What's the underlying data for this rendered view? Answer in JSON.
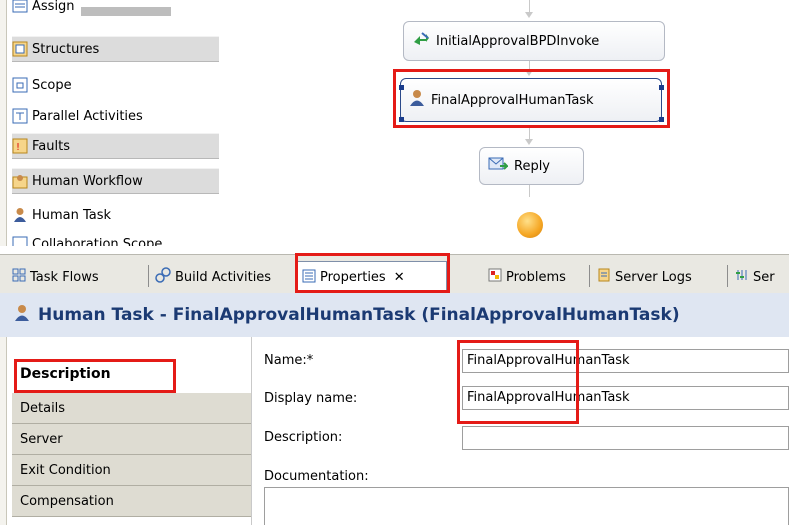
{
  "palette": {
    "items": [
      {
        "label": "Assign",
        "icon": "assign-icon",
        "drawer": false
      },
      {
        "label": "Structures",
        "icon": "structures-icon",
        "drawer": true
      },
      {
        "label": "Scope",
        "icon": "scope-icon",
        "drawer": false
      },
      {
        "label": "Parallel Activities",
        "icon": "parallel-activities-icon",
        "drawer": false
      },
      {
        "label": "Faults",
        "icon": "faults-icon",
        "drawer": true
      },
      {
        "label": "Human Workflow",
        "icon": "human-workflow-icon",
        "drawer": true
      },
      {
        "label": "Human Task",
        "icon": "human-task-icon",
        "drawer": false
      },
      {
        "label": "Collaboration Scope",
        "icon": "collaboration-scope-icon",
        "drawer": false
      }
    ]
  },
  "flow": {
    "nodes": {
      "invoke": "InitialApprovalBPDInvoke",
      "human_task": "FinalApprovalHumanTask",
      "reply": "Reply"
    }
  },
  "tabs": [
    {
      "label": "Task Flows",
      "icon": "task-flows-icon"
    },
    {
      "label": "Build Activities",
      "icon": "build-activities-icon"
    },
    {
      "label": "Properties",
      "icon": "properties-icon",
      "active": true
    },
    {
      "label": "Problems",
      "icon": "problems-icon"
    },
    {
      "label": "Server Logs",
      "icon": "server-logs-icon"
    },
    {
      "label": "Ser",
      "icon": "servers-icon"
    }
  ],
  "properties": {
    "title": "Human Task - FinalApprovalHumanTask (FinalApprovalHumanTask)",
    "sections": [
      "Description",
      "Details",
      "Server",
      "Exit Condition",
      "Compensation"
    ],
    "active_section": "Description",
    "fields": {
      "name_label": "Name:*",
      "name_value": "FinalApprovalHumanTask",
      "display_name_label": "Display name:",
      "display_name_value": "FinalApprovalHumanTask",
      "description_label": "Description:",
      "description_value": "",
      "documentation_label": "Documentation:"
    }
  },
  "colors": {
    "highlight": "#e41b17",
    "title_text": "#1b3a73",
    "title_bg": "#dfe6f2",
    "end_event": "#f5a623"
  }
}
